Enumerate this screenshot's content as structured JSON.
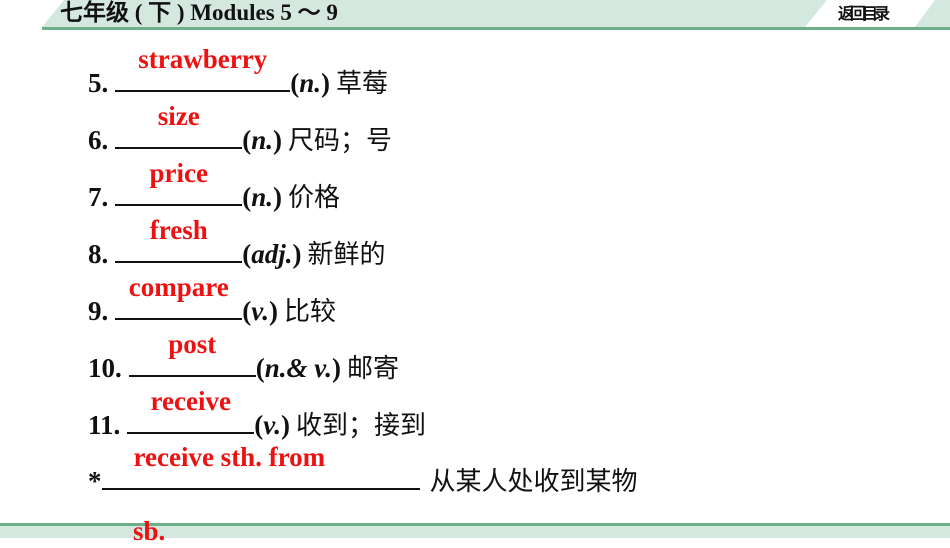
{
  "header": {
    "title": "七年级 ( 下 ) Modules 5 ～ 9",
    "back_label": "返回目录"
  },
  "colors": {
    "band": "#d5e8df",
    "band_line": "#6fae8a",
    "answer": "#ee1111",
    "text": "#111111"
  },
  "items": [
    {
      "num": "5.",
      "answer": "strawberry",
      "pos": "n.",
      "meaning": "草莓"
    },
    {
      "num": "6.",
      "answer": "size",
      "pos": "n.",
      "meaning": "尺码；号"
    },
    {
      "num": "7.",
      "answer": "price",
      "pos": "n.",
      "meaning": "价格"
    },
    {
      "num": "8.",
      "answer": "fresh",
      "pos": "adj.",
      "meaning": "新鲜的"
    },
    {
      "num": "9.",
      "answer": "compare",
      "pos": "v.",
      "meaning": "比较"
    },
    {
      "num": "10.",
      "answer": "post",
      "pos": "n.& v.",
      "meaning": "邮寄"
    },
    {
      "num": "11.",
      "answer": "receive",
      "pos": "v.",
      "meaning": "收到；接到"
    }
  ],
  "phrase": {
    "marker": "*",
    "answer_line1": "receive sth. from",
    "answer_line2": "sb.",
    "meaning": "从某人处收到某物"
  }
}
